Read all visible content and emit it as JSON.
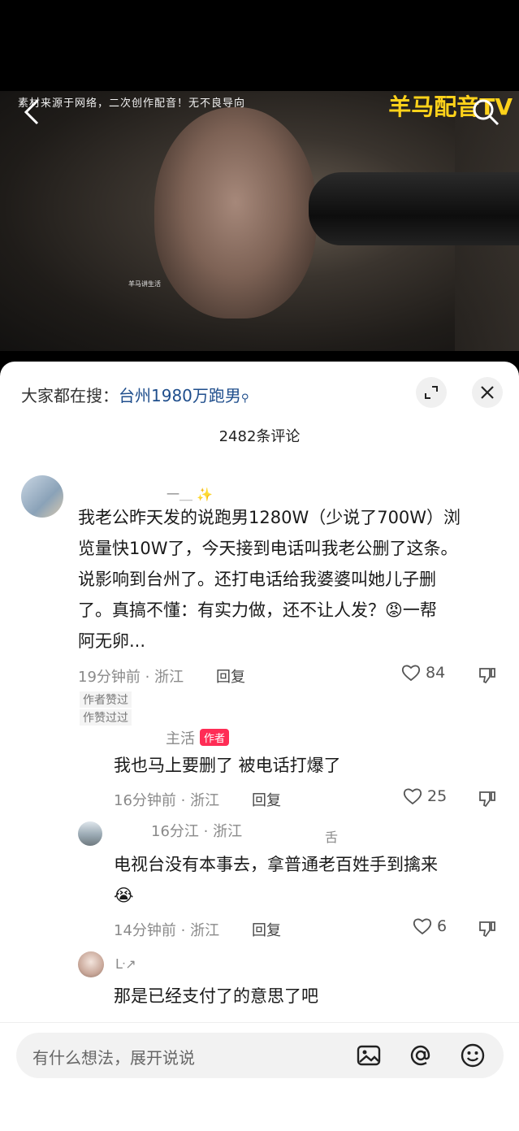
{
  "video": {
    "watermark": "素材来源于网络，二次创作配音！无不良导向",
    "brand": "羊马配音TV",
    "caption": "羊马讲生活"
  },
  "search_bar": {
    "prefix": "大家都在搜：",
    "keyword": "台州1980万跑男",
    "search_glyph": "⚲"
  },
  "comment_count": "2482条评论",
  "comments": [
    {
      "username": "一＿ ✨",
      "text_lines": [
        "我老公昨天发的说跑男1280W（少说了700W）浏",
        "览量快10W了，今天接到电话叫我老公删了这条。",
        "说影响到台州了。还打电话给我婆婆叫她儿子删",
        "了。真搞不懂：有实力做，还不让人发？😡一帮",
        "阿无卵..."
      ],
      "time": "19分钟前 · 浙江",
      "reply": "回复",
      "likes": "84",
      "tags": [
        "作者赞过",
        "作赞过过"
      ]
    },
    {
      "username": "主活",
      "badge": "作者",
      "text": "我也马上要删了 被电话打爆了",
      "time": "16分钟前 · 浙江",
      "reply": "回复",
      "likes": "25"
    },
    {
      "username": "16分江 · 浙江",
      "username_extra": "舌",
      "text_lines": [
        "电视台没有本事去，拿普通老百姓手到擒来",
        "😭"
      ],
      "time": "14分钟前 · 浙江",
      "reply": "回复",
      "likes": "6"
    },
    {
      "username": "ᒷ↗",
      "text": "那是已经支付了的意思了吧"
    }
  ],
  "composer": {
    "placeholder": "有什么想法，展开说说"
  },
  "icons": [
    "back-icon",
    "search-icon",
    "expand-icon",
    "close-icon",
    "heart-icon",
    "dislike-icon",
    "image-icon",
    "at-icon",
    "emoji-icon"
  ]
}
